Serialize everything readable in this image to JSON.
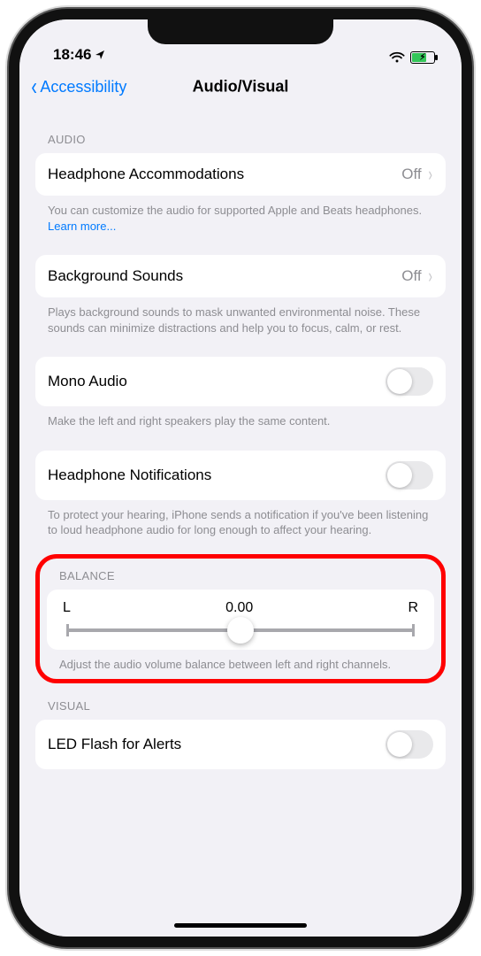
{
  "status": {
    "time": "18:46"
  },
  "nav": {
    "back_label": "Accessibility",
    "title": "Audio/Visual"
  },
  "sections": {
    "audio_header": "AUDIO",
    "headphone_accommodations": {
      "label": "Headphone Accommodations",
      "value": "Off",
      "footer_prefix": "You can customize the audio for supported Apple and Beats headphones. ",
      "footer_link": "Learn more..."
    },
    "background_sounds": {
      "label": "Background Sounds",
      "value": "Off",
      "footer": "Plays background sounds to mask unwanted environmental noise. These sounds can minimize distractions and help you to focus, calm, or rest."
    },
    "mono_audio": {
      "label": "Mono Audio",
      "footer": "Make the left and right speakers play the same content."
    },
    "headphone_notifications": {
      "label": "Headphone Notifications",
      "footer": "To protect your hearing, iPhone sends a notification if you've been listening to loud headphone audio for long enough to affect your hearing."
    },
    "balance": {
      "header": "BALANCE",
      "left": "L",
      "value": "0.00",
      "right": "R",
      "footer": "Adjust the audio volume balance between left and right channels."
    },
    "visual_header": "VISUAL",
    "led_flash": {
      "label": "LED Flash for Alerts"
    }
  }
}
